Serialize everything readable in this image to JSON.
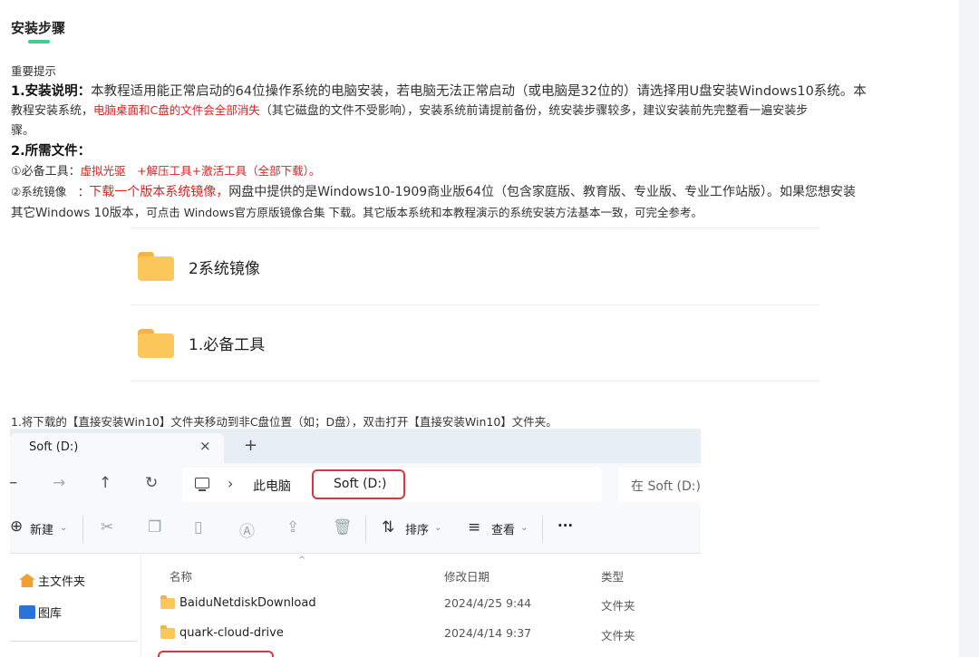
{
  "section": {
    "title": "安装步骤"
  },
  "notice": {
    "heading": "重要提示",
    "item1": {
      "label": "1.安装说明：",
      "text_a": "本教程适用能正常启动的64位操作系统的电脑安装，若电脑无法正常启动（或电脑是32位的）请选择用U盘安装Windows10系统。本",
      "text_b1": "教程安装系统，",
      "warn": "电脑桌面和C盘的文件会全部消失",
      "text_b2": "（其它磁盘的文件不受影响），安装系统前请提前备份，统安装步骤较多，建议安装前先完整看一遍安装步",
      "text_c": "骤。"
    },
    "item2": {
      "label": "2.所需文件：",
      "tools_label": "①必备工具：",
      "tools_links": "虚拟光驱　+解压工具+激活工具（全部下载）。",
      "image_label": "②系统镜像　：",
      "image_link": "下载一个版本系统镜像，",
      "image_text_a": "网盘中提供的是Windows10-1909商业版64位（包含家庭版、教育版、专业版、专业工作站版）。如果您想安装",
      "image_text_b1": "其它Windows 10版本，",
      "image_text_b2": "可",
      "image_text_b3": "点击 Windows官方原版镜像合集 下载。其它版本系统和本教程演示的系统安装方法基本一致，可完全参考。"
    }
  },
  "folders": [
    {
      "name": "2系统镜像",
      "icon": "folder-icon"
    },
    {
      "name": "1.必备工具",
      "icon": "folder-icon"
    }
  ],
  "step1": "1.将下载的【直接安装Win10】文件夹移动到非C盘位置（如；D盘），双击打开【直接安装Win10】文件夹。",
  "explorer": {
    "tab_title": "Soft (D:)",
    "close_glyph": "×",
    "new_tab_glyph": "+",
    "breadcrumb_pc": "此电脑",
    "breadcrumb_drive": "Soft (D:)",
    "search_placeholder": "在 Soft (D:)",
    "toolbar": {
      "new_label": "新建",
      "sort_label": "排序",
      "view_label": "查看",
      "more_glyph": "···"
    },
    "sidebar": [
      {
        "label": "主文件夹",
        "icon": "home-icon"
      },
      {
        "label": "图库",
        "icon": "gallery-icon"
      }
    ],
    "columns": {
      "name": "名称",
      "modified": "修改日期",
      "type": "类型"
    },
    "rows": [
      {
        "name": "BaiduNetdiskDownload",
        "modified": "2024/4/25 9:44",
        "type": "文件夹"
      },
      {
        "name": "quark-cloud-drive",
        "modified": "2024/4/14 9:37",
        "type": "文件夹"
      }
    ]
  },
  "colors": {
    "accent_green": "#3ccf8f",
    "warn_red": "#e02020",
    "highlight_box": "#d9363e"
  }
}
